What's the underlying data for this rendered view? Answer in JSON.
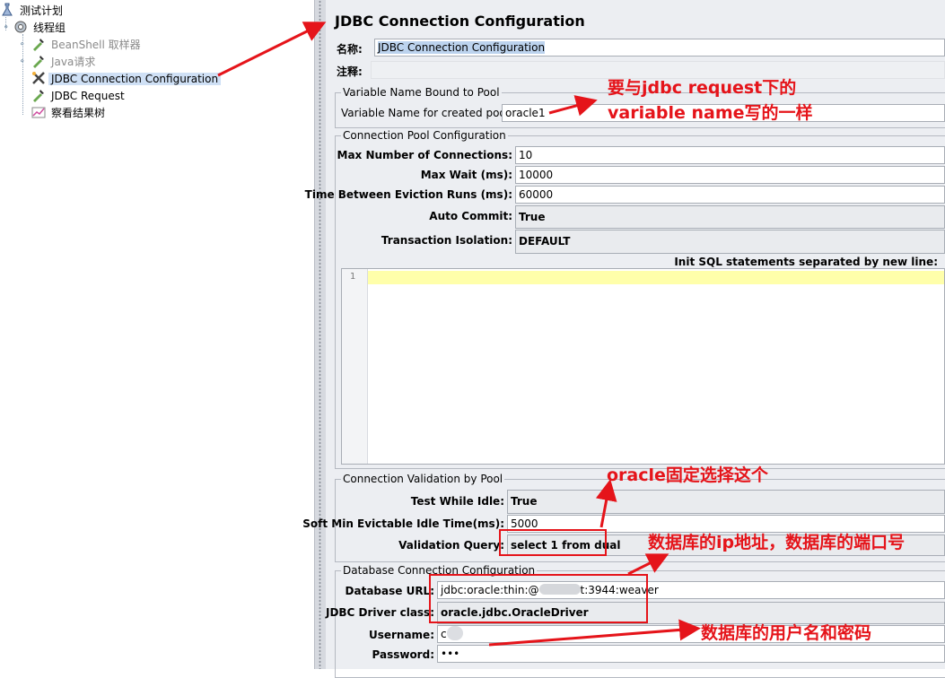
{
  "tree": {
    "items": [
      {
        "label": "测试计划",
        "icon": "test-plan-icon"
      },
      {
        "label": "线程组",
        "icon": "thread-group-gear-icon"
      },
      {
        "label": "BeanShell 取样器",
        "icon": "sampler-pipette-icon"
      },
      {
        "label": "Java请求",
        "icon": "sampler-pipette-icon"
      },
      {
        "label": "JDBC Connection Configuration",
        "icon": "config-wrench-icon"
      },
      {
        "label": "JDBC Request",
        "icon": "sampler-pipette-icon"
      },
      {
        "label": "察看结果树",
        "icon": "listener-chart-icon"
      }
    ]
  },
  "panel": {
    "title": "JDBC Connection Configuration",
    "name_label": "名称:",
    "name_value": "JDBC Connection Configuration",
    "comment_label": "注释:",
    "comment_value": "",
    "var_group": {
      "title": "Variable Name Bound to Pool",
      "label": "Variable Name for created pool:",
      "value": "oracle1"
    },
    "pool_group": {
      "title": "Connection Pool Configuration",
      "max_conn_label": "Max Number of Connections:",
      "max_conn_value": "10",
      "max_wait_label": "Max Wait (ms):",
      "max_wait_value": "10000",
      "eviction_label": "Time Between Eviction Runs (ms):",
      "eviction_value": "60000",
      "auto_commit_label": "Auto Commit:",
      "auto_commit_value": "True",
      "isolation_label": "Transaction Isolation:",
      "isolation_value": "DEFAULT",
      "init_sql_label": "Init SQL statements separated by new line:",
      "line_number": "1"
    },
    "validation_group": {
      "title": "Connection Validation by Pool",
      "test_idle_label": "Test While Idle:",
      "test_idle_value": "True",
      "soft_min_label": "Soft Min Evictable Idle Time(ms):",
      "soft_min_value": "5000",
      "query_label": "Validation Query:",
      "query_value": "select 1 from dual"
    },
    "db_group": {
      "title": "Database Connection Configuration",
      "url_label": "Database URL:",
      "url_value": "jdbc:oracle:thin:@",
      "url_tail": "t:3944:weaver",
      "driver_label": "JDBC Driver class:",
      "driver_value": "oracle.jdbc.OracleDriver",
      "user_label": "Username:",
      "user_value": "c",
      "pass_label": "Password:",
      "pass_value": "•••"
    }
  },
  "annotations": {
    "var_note_1": "要与jdbc request下的",
    "var_note_2": "variable name写的一样",
    "oracle_note": "oracle固定选择这个",
    "url_note": "数据库的ip地址，数据库的端口号",
    "cred_note": "数据库的用户名和密码",
    "color": "#e5141a"
  }
}
